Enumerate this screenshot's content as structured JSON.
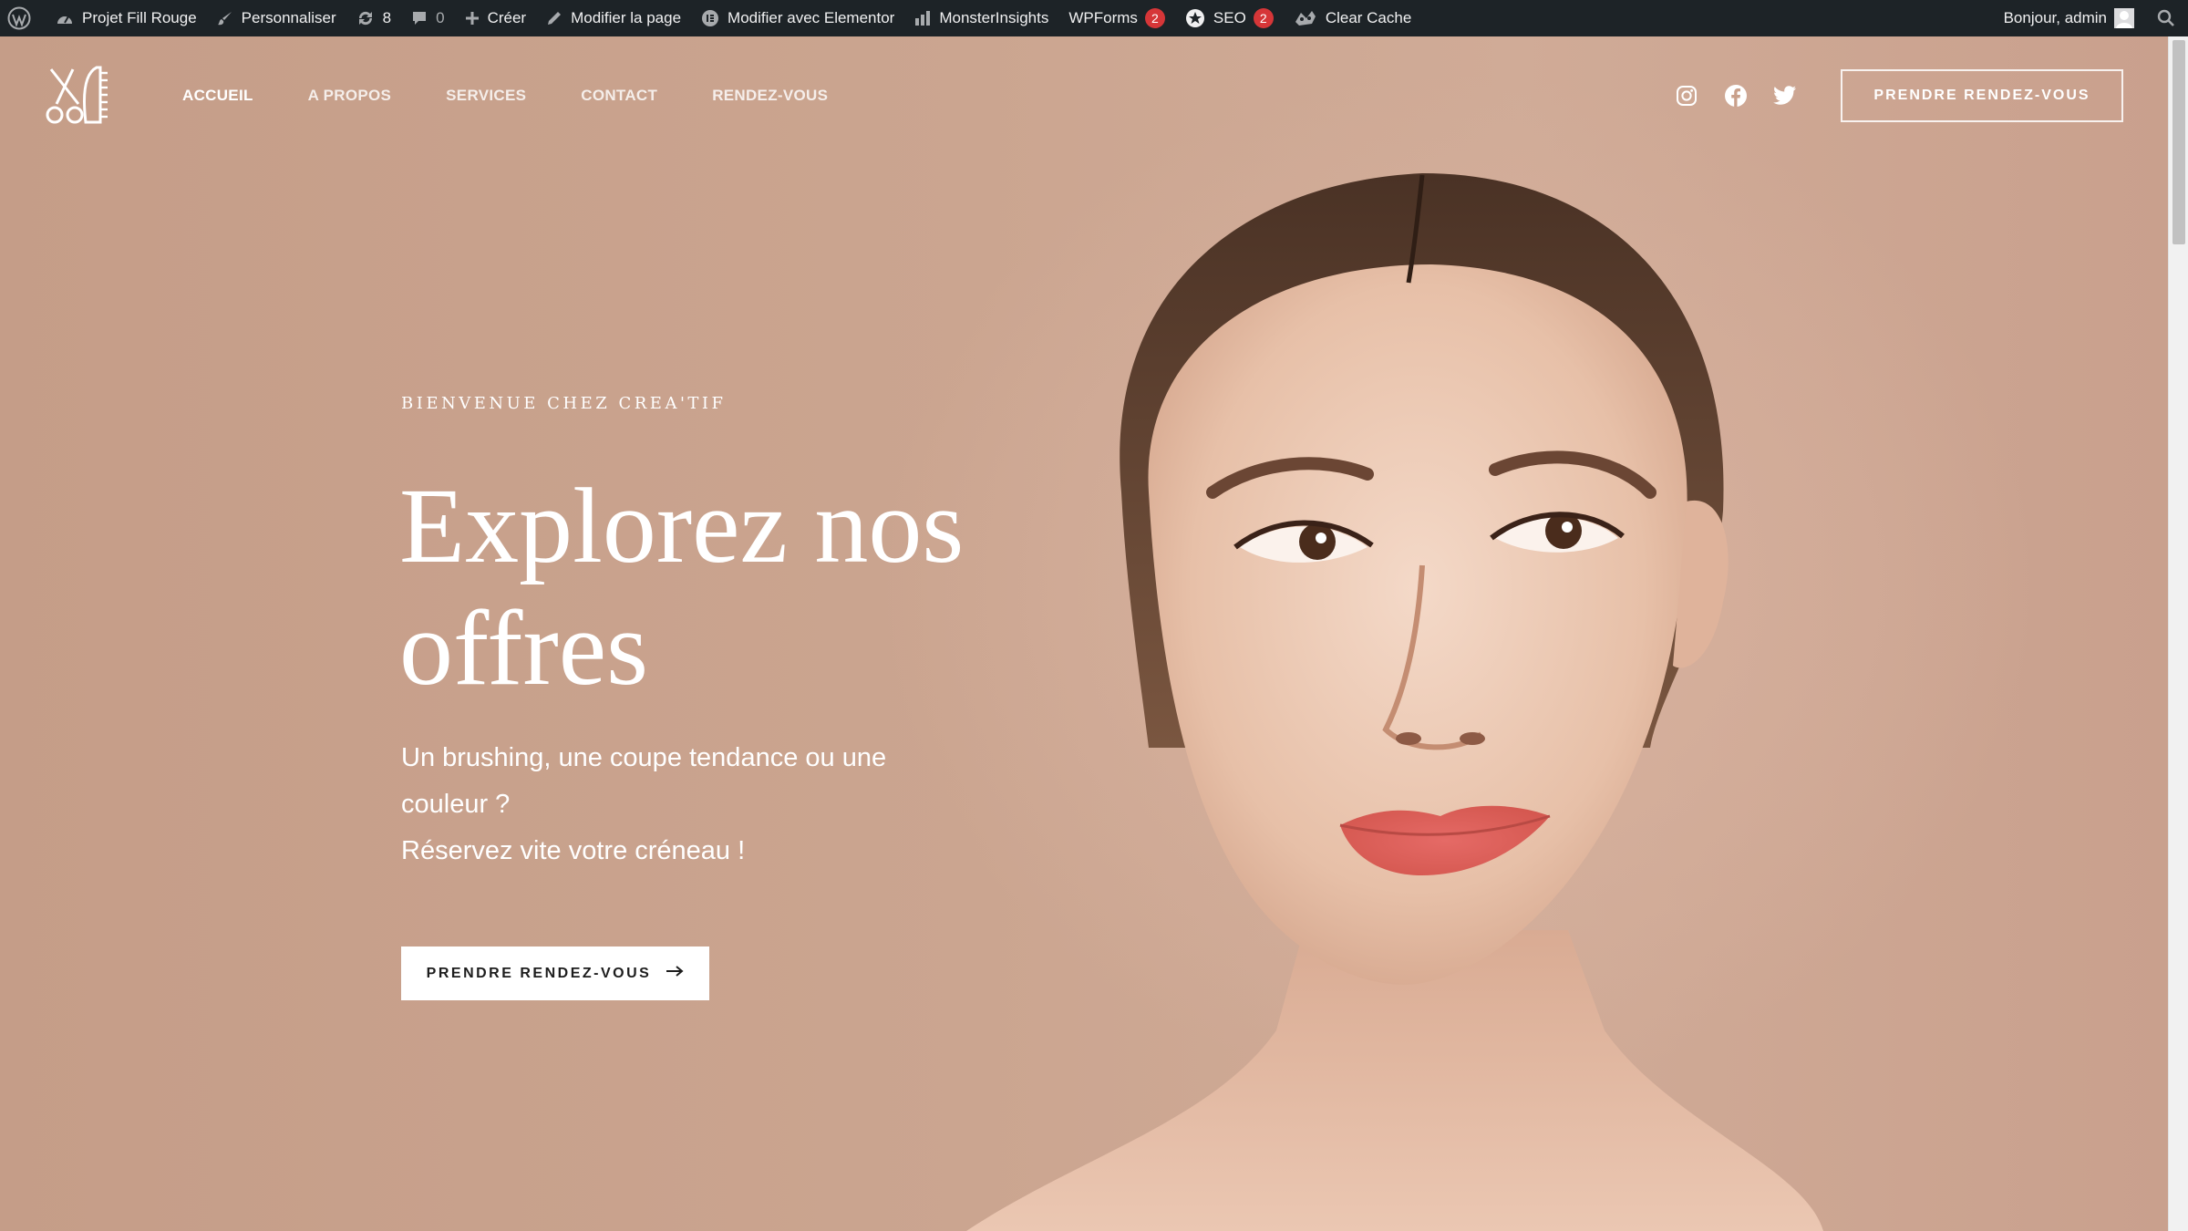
{
  "admin_bar": {
    "site_name": "Projet Fill Rouge",
    "customize": "Personnaliser",
    "updates_count": "8",
    "comments_count": "0",
    "new": "Créer",
    "edit_page": "Modifier la page",
    "edit_elementor": "Modifier avec Elementor",
    "monsterinsights": "MonsterInsights",
    "wpforms": "WPForms",
    "wpforms_badge": "2",
    "seo": "SEO",
    "seo_badge": "2",
    "clear_cache": "Clear Cache",
    "greeting": "Bonjour, admin"
  },
  "header": {
    "nav": [
      "ACCUEIL",
      "A PROPOS",
      "SERVICES",
      "CONTACT",
      "RENDEZ-VOUS"
    ],
    "active_nav": "ACCUEIL",
    "socials": [
      "instagram-icon",
      "facebook-icon",
      "twitter-icon"
    ],
    "cta_label": "PRENDRE RENDEZ-VOUS"
  },
  "hero": {
    "kicker": "BIENVENUE CHEZ CREA'TIF",
    "headline": "Explorez nos offres",
    "lead_line1": "Un brushing, une coupe tendance ou une couleur ?",
    "lead_line2": "Réservez vite votre créneau !",
    "cta_label": "PRENDRE RENDEZ-VOUS",
    "cta_icon": "arrow-right-icon"
  },
  "colors": {
    "admin_bar_bg": "#1d2327",
    "hero_bg": "#c9a08b",
    "badge": "#d63638",
    "text_light": "#ffffff"
  }
}
